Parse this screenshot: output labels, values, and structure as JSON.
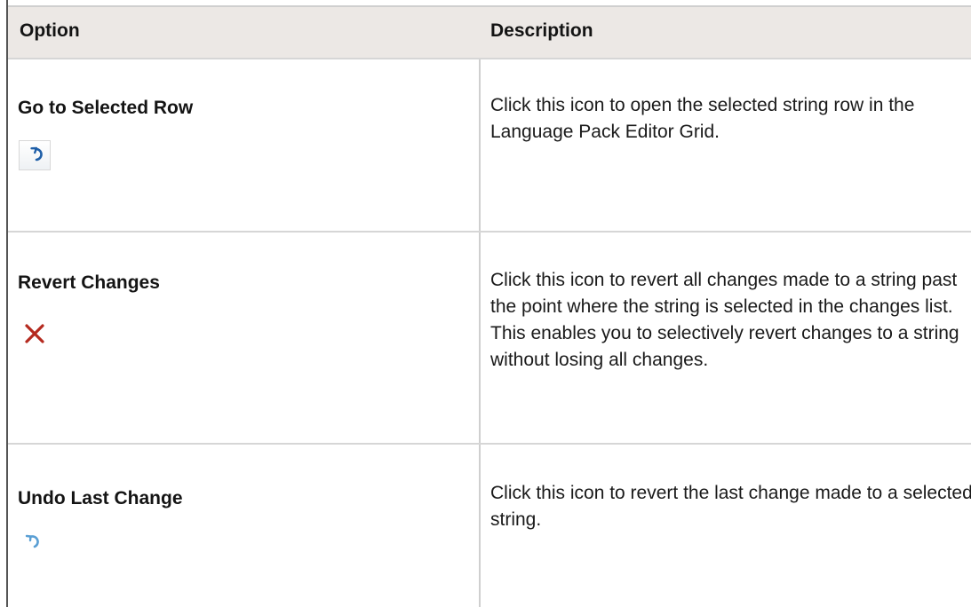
{
  "table": {
    "headers": {
      "option": "Option",
      "description": "Description"
    },
    "rows": [
      {
        "option": "Go to Selected Row",
        "icon": "go-to-row-icon",
        "description": "Click this icon to open the selected string row in the Language Pack Editor Grid."
      },
      {
        "option": "Revert Changes",
        "icon": "revert-x-icon",
        "description": "Click this icon to revert all changes made to a string past the point where the string is selected in the changes list. This enables you to selectively revert changes to a string without losing all changes."
      },
      {
        "option": "Undo Last Change",
        "icon": "undo-icon",
        "description": "Click this icon to revert the last change made to a selected string."
      }
    ]
  },
  "colors": {
    "header_bg": "#ece8e5",
    "grid_line": "#d6d6d6",
    "go_icon": "#1f5fa8",
    "revert_icon": "#b52a1f",
    "undo_icon": "#5a9fd4"
  }
}
